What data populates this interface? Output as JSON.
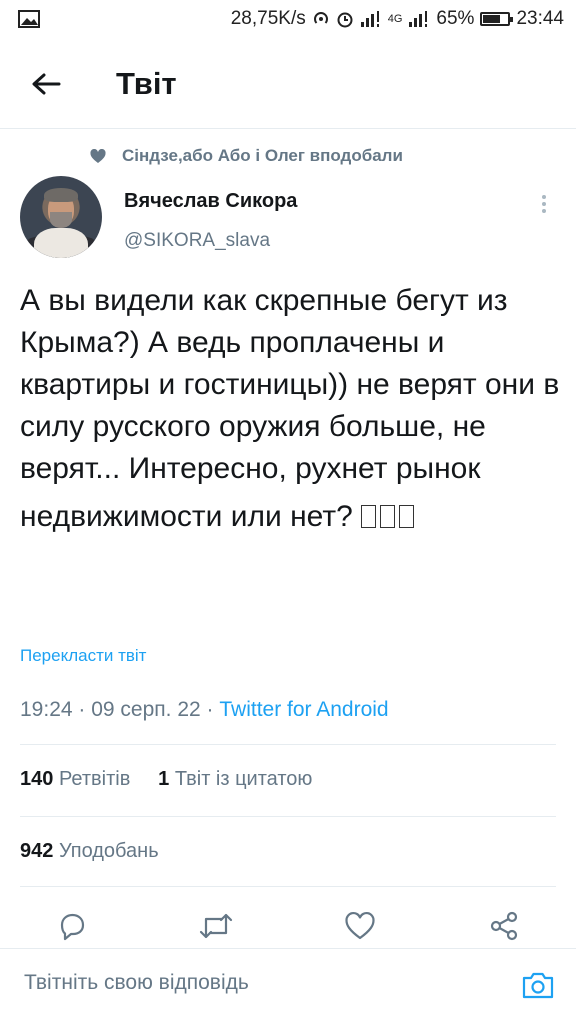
{
  "status_bar": {
    "speed": "28,75K/s",
    "network": "4G",
    "battery": "65%",
    "battery_level": 0.65,
    "time": "23:44"
  },
  "header": {
    "title": "Твіт"
  },
  "liked_by": "Сіндзе,або Або і Олег вподобали",
  "tweet": {
    "author_name": "Вячеслав Сикора",
    "author_handle": "@SIKORA_slava",
    "text": "А вы видели как скрепные бегут из Крыма?) А ведь проплачены и квартиры и гостиницы)) не верят они в силу русского оружия больше, не верят... Интересно, рухнет рынок недвижимости или нет?",
    "translate_label": "Перекласти твіт",
    "time": "19:24",
    "date": "09 серп. 22",
    "source": "Twitter for Android"
  },
  "stats": {
    "retweets_count": "140",
    "retweets_label": "Ретвітів",
    "quotes_count": "1",
    "quotes_label": "Твіт із цитатою",
    "likes_count": "942",
    "likes_label": "Уподобань"
  },
  "reply": {
    "placeholder": "Твітніть свою відповідь"
  },
  "icons": {
    "heart_small": "heart-icon",
    "reply": "comment-icon",
    "retweet": "retweet-icon",
    "like": "heart-outline-icon",
    "share": "share-icon",
    "camera": "camera-icon"
  },
  "colors": {
    "accent": "#1da1f2",
    "secondary": "#657786",
    "text": "#14171a"
  }
}
